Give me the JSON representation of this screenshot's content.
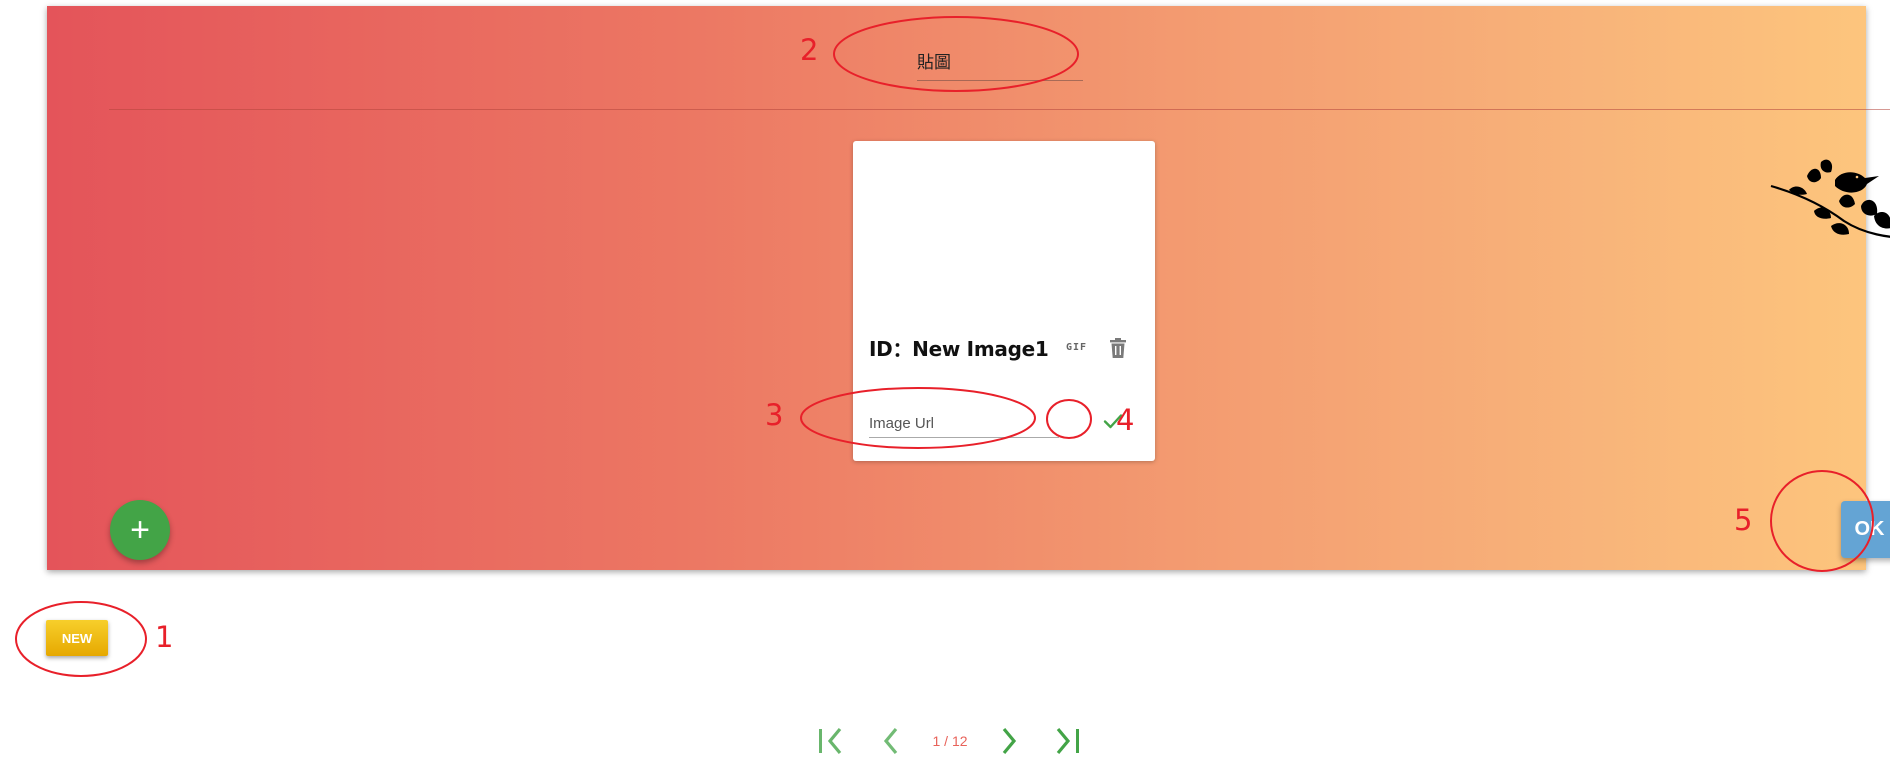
{
  "editor": {
    "title_value": "貼圖",
    "card": {
      "id_text": "ID：New Image1",
      "gif_label": "GIF",
      "url_placeholder": "Image Url"
    },
    "add_label": "+",
    "ok_label": "OK"
  },
  "new_button_label": "NEW",
  "pagination": {
    "indicator": "1 / 12"
  },
  "annotations": [
    "1",
    "2",
    "3",
    "4",
    "5"
  ],
  "colors": {
    "annotation": "#e8202a",
    "gradient_start": "#e4545a",
    "gradient_end": "#fdc57d",
    "add_button": "#43a447",
    "ok_button": "#64a4d4",
    "new_button": "#f2bd16",
    "pager_icon": "#43a447"
  },
  "icons": [
    "gif-icon",
    "trash-icon",
    "check-icon",
    "bird-on-branch-icon",
    "first-page-icon",
    "prev-page-icon",
    "next-page-icon",
    "last-page-icon"
  ]
}
